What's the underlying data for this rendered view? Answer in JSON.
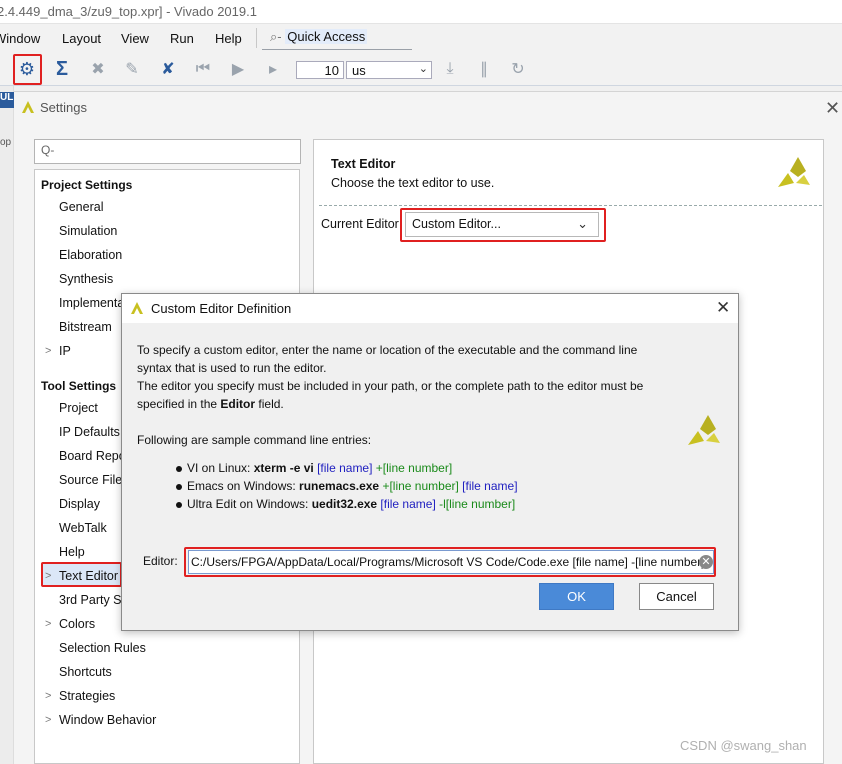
{
  "window": {
    "title": "2.4.449_dma_3/zu9_top.xpr] - Vivado 2019.1"
  },
  "menu": {
    "items": [
      "Window",
      "Layout",
      "View",
      "Run",
      "Help"
    ]
  },
  "quick_access": {
    "label": "Quick Access"
  },
  "toolbar": {
    "time_value": "10",
    "time_unit": "us"
  },
  "side_strip": {
    "labels": [
      "UL",
      "op"
    ]
  },
  "settings": {
    "title": "Settings",
    "search_placeholder": "Q-",
    "project_settings": {
      "heading": "Project Settings",
      "items": [
        "General",
        "Simulation",
        "Elaboration",
        "Synthesis",
        "Implementation",
        "Bitstream",
        "IP"
      ]
    },
    "tool_settings": {
      "heading": "Tool Settings",
      "items": [
        "Project",
        "IP Defaults",
        "Board Repository",
        "Source File",
        "Display",
        "WebTalk",
        "Help",
        "Text Editor",
        "3rd Party Simulators",
        "Colors",
        "Selection Rules",
        "Shortcuts",
        "Strategies",
        "Window Behavior"
      ]
    },
    "text_editor": {
      "title": "Text Editor",
      "subtitle": "Choose the text editor to use.",
      "current_editor_label": "Current Editor",
      "current_editor_value": "Custom Editor..."
    }
  },
  "dialog": {
    "title": "Custom Editor Definition",
    "desc_lines": [
      "To specify a custom editor, enter the name or location of the executable and the command line",
      "syntax that is used to run the editor.",
      "The editor you specify must be included in your path, or the complete path to the editor must be"
    ],
    "desc_last_prefix": "specified in the ",
    "desc_last_bold": "Editor",
    "desc_last_suffix": " field.",
    "samples_heading": "Following are sample command line entries:",
    "samples": [
      {
        "prefix": "VI on Linux: ",
        "cmd": "xterm -e vi",
        "blue1": " [file name]",
        "green": " +[line number]",
        "blue2": ""
      },
      {
        "prefix": "Emacs on Windows: ",
        "cmd": "runemacs.exe",
        "blue1": "",
        "green": " +[line number]",
        "blue2": " [file name]"
      },
      {
        "prefix": "Ultra Edit on Windows: ",
        "cmd": "uedit32.exe",
        "blue1": " [file name]",
        "green": " -l[line number]",
        "blue2": ""
      }
    ],
    "editor_label": "Editor:",
    "editor_value": "C:/Users/FPGA/AppData/Local/Programs/Microsoft VS Code/Code.exe [file name] -[line number]",
    "ok_label": "OK",
    "cancel_label": "Cancel"
  },
  "watermark": "CSDN @swang_shan",
  "colors": {
    "accent": "#4a8ad8",
    "highlight_box": "#e02020",
    "logo": "#c8c020"
  }
}
